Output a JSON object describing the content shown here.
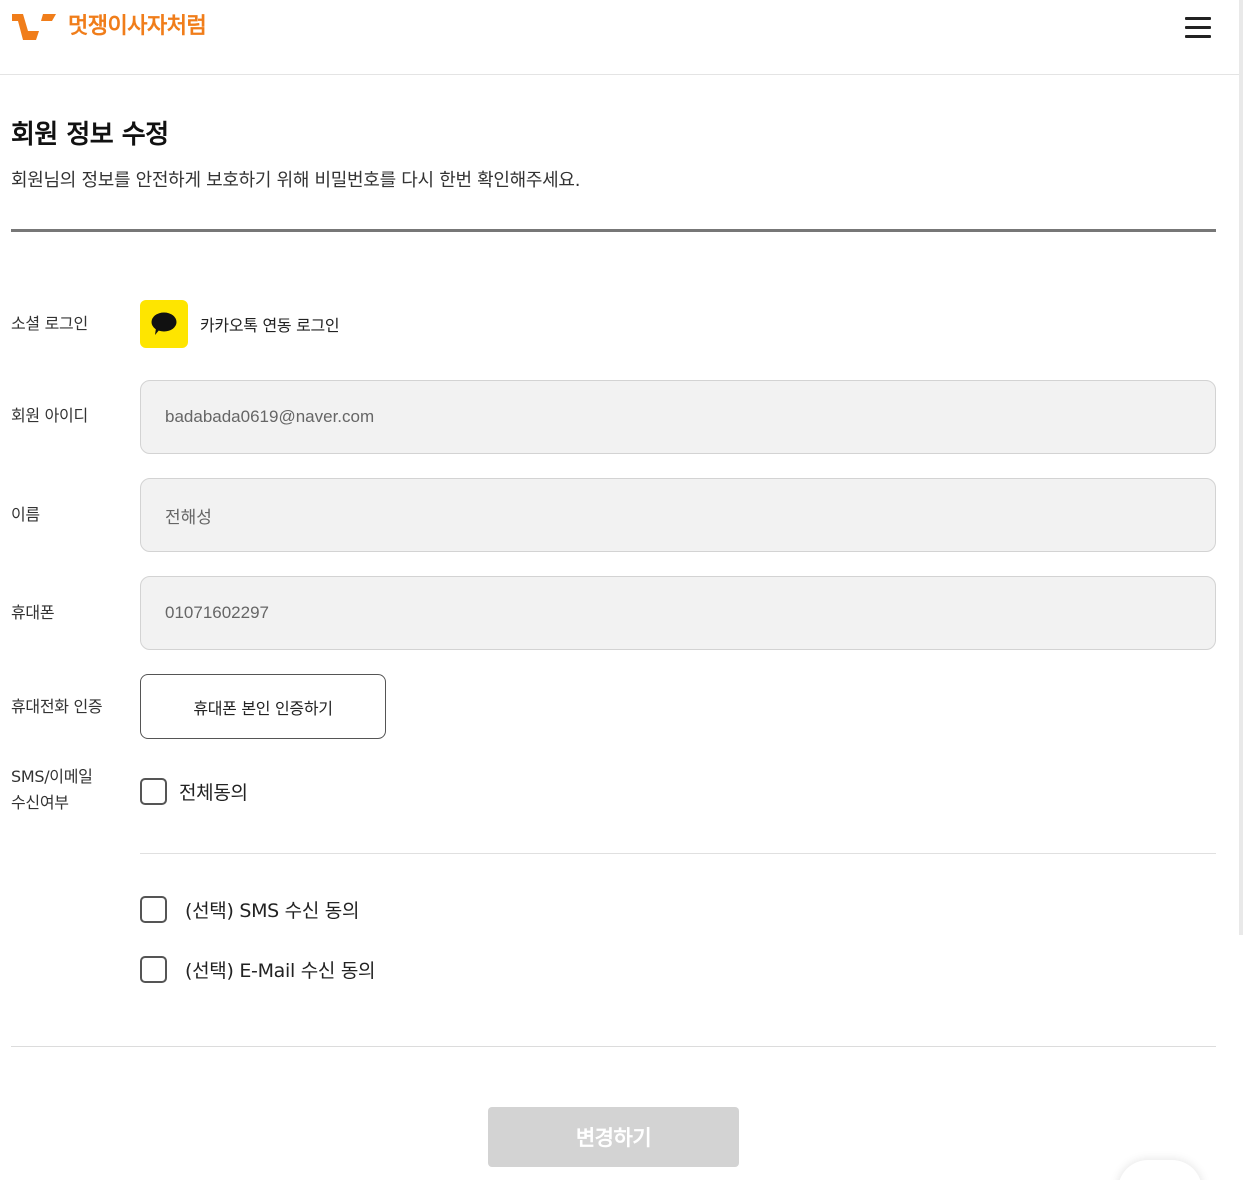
{
  "header": {
    "logo_text": "멋쟁이사자처럼",
    "logo_icon": "lion-logo-icon",
    "menu_icon": "hamburger-menu-icon",
    "brand_color": "#f07d1a"
  },
  "page": {
    "title": "회원 정보 수정",
    "description": "회원님의 정보를 안전하게 보호하기 위해 비밀번호를 다시 한번 확인해주세요."
  },
  "social": {
    "label": "소셜 로그인",
    "icon": "kakao-talk-icon",
    "icon_color": "#fee500",
    "text": "카카오톡 연동 로그인"
  },
  "fields": {
    "user_id": {
      "label": "회원 아이디",
      "value": "badabada0619@naver.com"
    },
    "name": {
      "label": "이름",
      "value": "전해성"
    },
    "phone": {
      "label": "휴대폰",
      "value": "01071602297"
    }
  },
  "verify": {
    "label": "휴대전화 인증",
    "button": "휴대폰 본인 인증하기"
  },
  "consent": {
    "label_line1": "SMS/이메일",
    "label_line2": "수신여부",
    "all": "전체동의",
    "sms": "(선택) SMS 수신 동의",
    "email": "(선택) E-Mail 수신 동의"
  },
  "submit": {
    "label": "변경하기"
  }
}
